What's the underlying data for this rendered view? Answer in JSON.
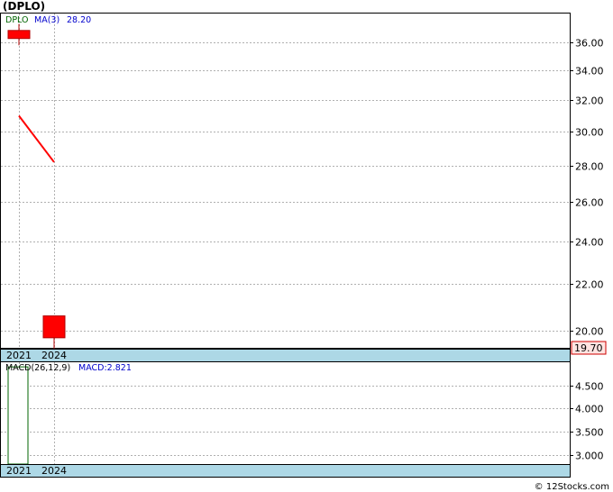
{
  "ticker_title": "(DPLO)",
  "credit": "© 12Stocks.com",
  "colors": {
    "candle": "#ff0000",
    "candle_border": "#b00000",
    "ma_line": "#ff0000",
    "macd_bar": "#ffffff",
    "macd_bar_border": "#006400",
    "axis_band": "#add8e6",
    "price_tag_bg": "#ffe4e1",
    "grid": "#b0b0b0",
    "legend_symbol": "#006400",
    "legend_value": "#0000cc"
  },
  "chart_data": [
    {
      "type": "candlestick",
      "legend": {
        "symbol": "DPLO",
        "ma_label": "MA(3)",
        "ma_value": "28.20"
      },
      "categories": [
        "2021",
        "2024"
      ],
      "candles": [
        {
          "x": "2021",
          "open": 36.9,
          "high": 37.4,
          "low": 35.8,
          "close": 36.3
        },
        {
          "x": "2024",
          "open": 20.6,
          "high": 20.6,
          "low": 19.2,
          "close": 19.7
        }
      ],
      "ma": [
        {
          "x": "2021",
          "value": 31.0
        },
        {
          "x": "2024",
          "value": 28.2
        }
      ],
      "last_price_label": "19.70",
      "yticks": [
        "20.00",
        "22.00",
        "24.00",
        "26.00",
        "28.00",
        "30.00",
        "32.00",
        "34.00",
        "36.00"
      ],
      "ylim": [
        19.3,
        38.2
      ],
      "y_scale": "log",
      "grid": true
    },
    {
      "type": "bar",
      "legend": {
        "label": "MACD(26,12,9)",
        "value_label": "MACD:2.821"
      },
      "categories": [
        "2021",
        "2024"
      ],
      "values": [
        4.9,
        null
      ],
      "yticks": [
        "3.000",
        "3.500",
        "4.000",
        "4.500"
      ],
      "ylim": [
        2.8,
        5.0
      ],
      "grid": true
    }
  ]
}
